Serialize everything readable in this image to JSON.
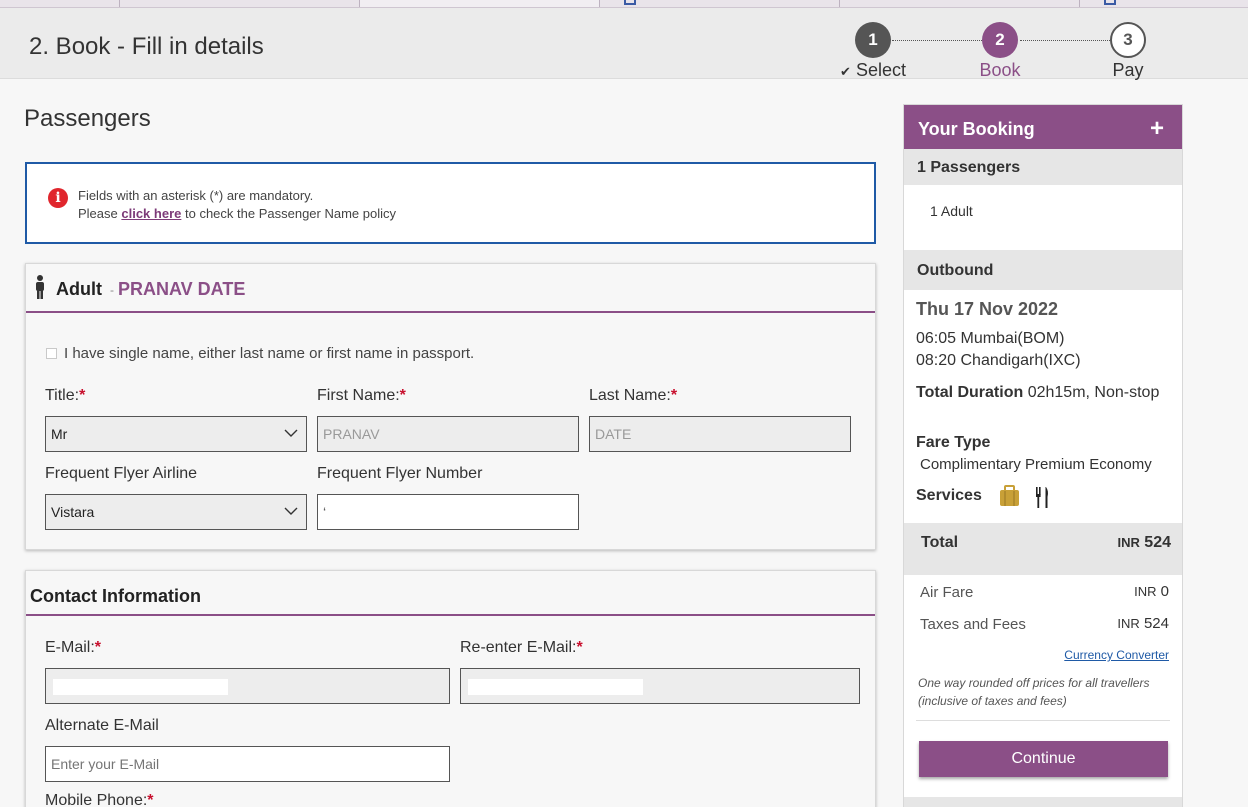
{
  "header": {
    "title": "2. Book - Fill in details"
  },
  "steps": [
    {
      "number": "1",
      "label": "Select",
      "check": "✔"
    },
    {
      "number": "2",
      "label": "Book"
    },
    {
      "number": "3",
      "label": "Pay"
    }
  ],
  "section": {
    "title": "Passengers"
  },
  "notice": {
    "line1": "Fields with an asterisk (*) are mandatory.",
    "line2_prefix": "Please",
    "link": "click here",
    "line2_suffix": "to check the Passenger Name policy"
  },
  "passenger": {
    "type": "Adult",
    "dash": "-",
    "name": "PRANAV DATE",
    "single_name_label": "I have single name, either last name or first name in passport.",
    "title_label": "Title:",
    "title_value": "Mr",
    "first_name_label": "First Name:",
    "first_name_value": "PRANAV",
    "last_name_label": "Last Name:",
    "last_name_value": "DATE",
    "ff_airline_label": "Frequent Flyer Airline",
    "ff_airline_value": "Vistara",
    "ff_number_label": "Frequent Flyer Number",
    "ff_number_value": "‘"
  },
  "contact": {
    "title": "Contact Information",
    "email_label": "E-Mail:",
    "reemail_label": "Re-enter E-Mail:",
    "alt_email_label": "Alternate E-Mail",
    "alt_email_placeholder": "Enter your E-Mail",
    "mobile_label": "Mobile Phone:"
  },
  "required_mark": "*",
  "booking": {
    "title": "Your Booking",
    "toggle": "+",
    "passengers_heading": "1 Passengers",
    "passengers_detail": "1 Adult",
    "outbound_heading": "Outbound",
    "date": "Thu 17 Nov 2022",
    "dep": "06:05 Mumbai(BOM)",
    "arr": "08:20 Chandigarh(IXC)",
    "duration_label": "Total Duration",
    "duration_value": "02h15m, Non-stop",
    "fare_type_label": "Fare Type",
    "fare_type_value": "Complimentary Premium Economy",
    "services_label": "Services",
    "total_label": "Total",
    "currency": "INR",
    "total_value": "524",
    "air_fare_label": "Air Fare",
    "air_fare_value": "0",
    "taxes_label": "Taxes and Fees",
    "taxes_value": "524",
    "converter_link": "Currency Converter",
    "note": "One way rounded off prices for all travellers (inclusive of taxes and fees)",
    "continue_label": "Continue"
  },
  "colors": {
    "brand": "#8b4f87",
    "link": "#1f5aa6",
    "required": "#c8102e",
    "notice_border": "#1f5aa6"
  }
}
